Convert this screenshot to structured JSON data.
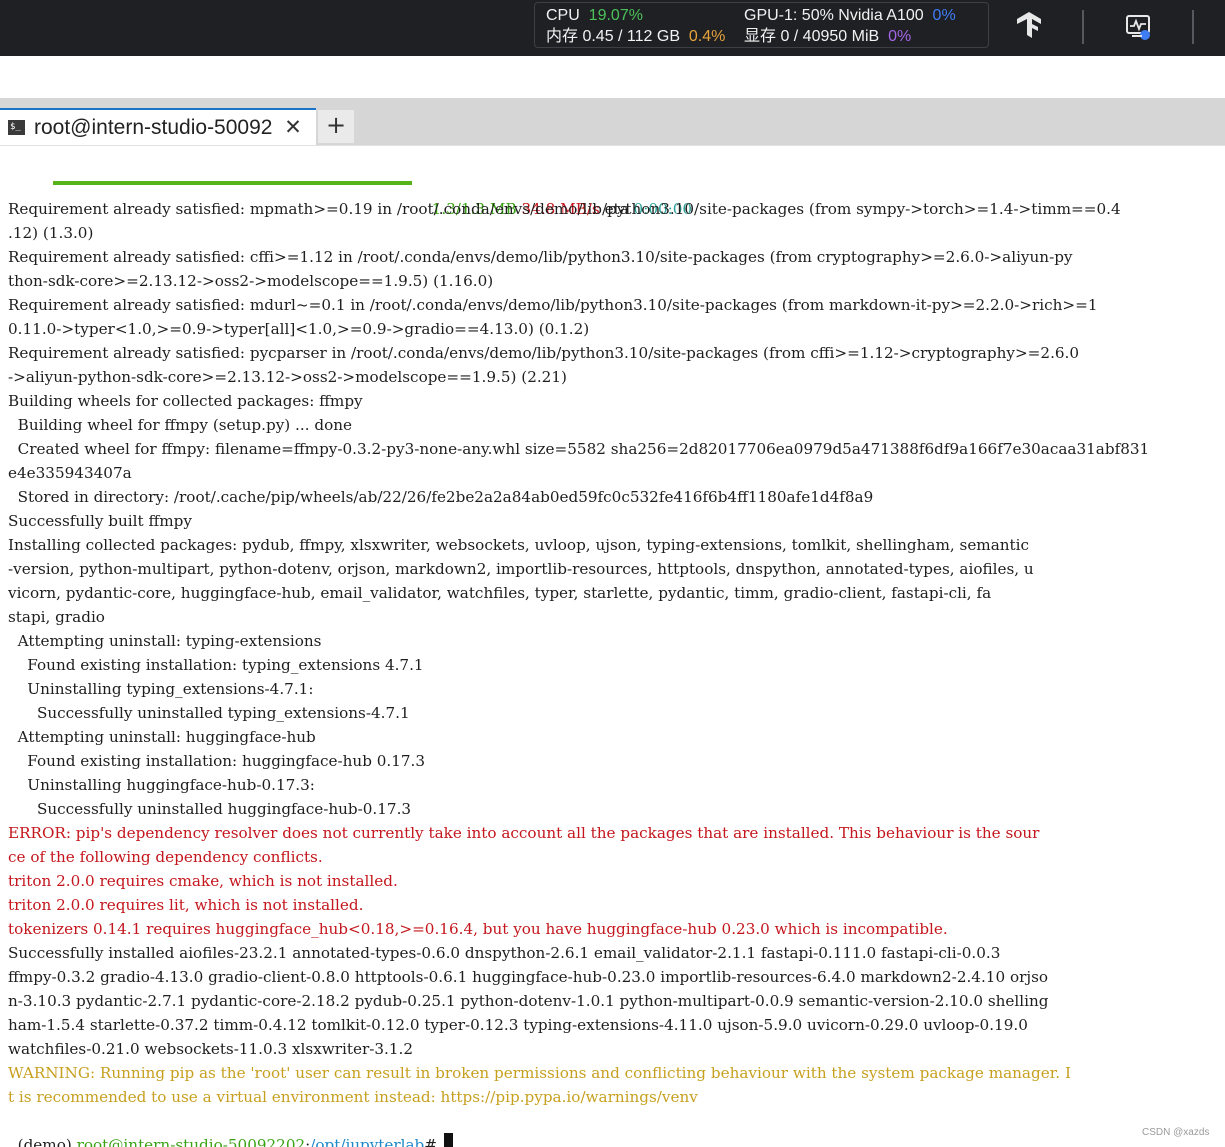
{
  "sysbar": {
    "cpu_label": "CPU",
    "cpu_value": "19.07%",
    "mem_label": "内存 0.45 / 112 GB",
    "mem_value": "0.4%",
    "gpu_label": "GPU-1: 50% Nvidia A100",
    "gpu_value": "0%",
    "vram_label": "显存 0 / 40950 MiB",
    "vram_value": "0%",
    "colors": {
      "green": "#4cc15a",
      "orange": "#e6a23c",
      "blue": "#3f7df7",
      "purple": "#a366e6"
    },
    "icons": [
      "tensorflow-icon",
      "resource-monitor-icon"
    ]
  },
  "tabbar": {
    "active_tab": "root@intern-studio-50092",
    "close_glyph": "✕",
    "add_glyph": "+",
    "terminal_glyph": "$_"
  },
  "terminal": {
    "progress": {
      "fraction": 1.0,
      "size": "1.3/1.3 MB",
      "speed": "34.8 MB/s",
      "eta_label": "eta",
      "eta": "0:00:00"
    },
    "lines": [
      "Requirement already satisfied: mpmath>=0.19 in /root/.conda/envs/demo/lib/python3.10/site-packages (from sympy->torch>=1.4->timm==0.4",
      ".12) (1.3.0)",
      "Requirement already satisfied: cffi>=1.12 in /root/.conda/envs/demo/lib/python3.10/site-packages (from cryptography>=2.6.0->aliyun-py",
      "thon-sdk-core>=2.13.12->oss2->modelscope==1.9.5) (1.16.0)",
      "Requirement already satisfied: mdurl~=0.1 in /root/.conda/envs/demo/lib/python3.10/site-packages (from markdown-it-py>=2.2.0->rich>=1",
      "0.11.0->typer<1.0,>=0.9->typer[all]<1.0,>=0.9->gradio==4.13.0) (0.1.2)",
      "Requirement already satisfied: pycparser in /root/.conda/envs/demo/lib/python3.10/site-packages (from cffi>=1.12->cryptography>=2.6.0",
      "->aliyun-python-sdk-core>=2.13.12->oss2->modelscope==1.9.5) (2.21)",
      "Building wheels for collected packages: ffmpy",
      "  Building wheel for ffmpy (setup.py) ... done",
      "  Created wheel for ffmpy: filename=ffmpy-0.3.2-py3-none-any.whl size=5582 sha256=2d82017706ea0979d5a471388f6df9a166f7e30acaa31abf831",
      "e4e335943407a",
      "  Stored in directory: /root/.cache/pip/wheels/ab/22/26/fe2be2a2a84ab0ed59fc0c532fe416f6b4ff1180afe1d4f8a9",
      "Successfully built ffmpy",
      "Installing collected packages: pydub, ffmpy, xlsxwriter, websockets, uvloop, ujson, typing-extensions, tomlkit, shellingham, semantic",
      "-version, python-multipart, python-dotenv, orjson, markdown2, importlib-resources, httptools, dnspython, annotated-types, aiofiles, u",
      "vicorn, pydantic-core, huggingface-hub, email_validator, watchfiles, typer, starlette, pydantic, timm, gradio-client, fastapi-cli, fa",
      "stapi, gradio",
      "  Attempting uninstall: typing-extensions",
      "    Found existing installation: typing_extensions 4.7.1",
      "    Uninstalling typing_extensions-4.7.1:",
      "      Successfully uninstalled typing_extensions-4.7.1",
      "  Attempting uninstall: huggingface-hub",
      "    Found existing installation: huggingface-hub 0.17.3",
      "    Uninstalling huggingface-hub-0.17.3:",
      "      Successfully uninstalled huggingface-hub-0.17.3"
    ],
    "error_lines": [
      "ERROR: pip's dependency resolver does not currently take into account all the packages that are installed. This behaviour is the sour",
      "ce of the following dependency conflicts.",
      "triton 2.0.0 requires cmake, which is not installed.",
      "triton 2.0.0 requires lit, which is not installed.",
      "tokenizers 0.14.1 requires huggingface_hub<0.18,>=0.16.4, but you have huggingface-hub 0.23.0 which is incompatible."
    ],
    "success_lines": [
      "Successfully installed aiofiles-23.2.1 annotated-types-0.6.0 dnspython-2.6.1 email_validator-2.1.1 fastapi-0.111.0 fastapi-cli-0.0.3",
      "ffmpy-0.3.2 gradio-4.13.0 gradio-client-0.8.0 httptools-0.6.1 huggingface-hub-0.23.0 importlib-resources-6.4.0 markdown2-2.4.10 orjso",
      "n-3.10.3 pydantic-2.7.1 pydantic-core-2.18.2 pydub-0.25.1 python-dotenv-1.0.1 python-multipart-0.0.9 semantic-version-2.10.0 shelling",
      "ham-1.5.4 starlette-0.37.2 timm-0.4.12 tomlkit-0.12.0 typer-0.12.3 typing-extensions-4.11.0 ujson-5.9.0 uvicorn-0.29.0 uvloop-0.19.0",
      "watchfiles-0.21.0 websockets-11.0.3 xlsxwriter-3.1.2"
    ],
    "warning_lines": [
      "WARNING: Running pip as the 'root' user can result in broken permissions and conflicting behaviour with the system package manager. I",
      "t is recommended to use a virtual environment instead: https://pip.pypa.io/warnings/venv"
    ],
    "prompt": {
      "env": "(demo) ",
      "user_host": "root@intern-studio-50092202",
      "sep": ":",
      "path": "/opt/jupyterlab",
      "symbol": "# "
    },
    "colors": {
      "error": "#c4161c",
      "warning": "#c8a020",
      "progress": "#57b31a"
    }
  },
  "watermark": "CSDN @xazds"
}
